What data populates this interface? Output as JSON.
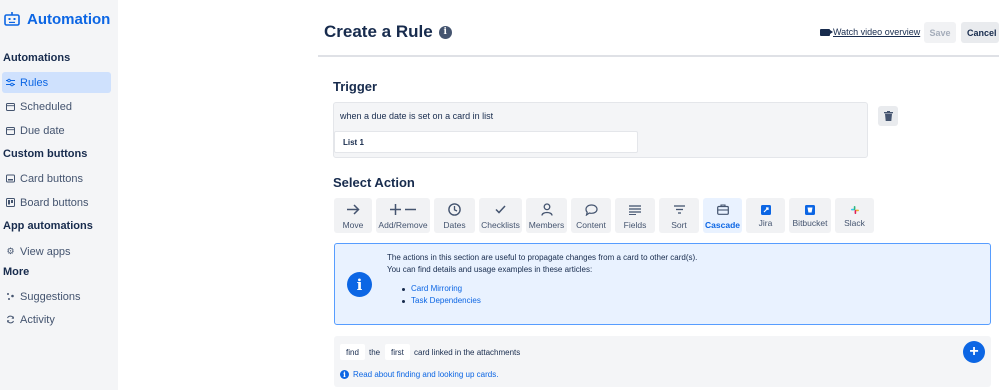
{
  "sidebar": {
    "brand": "Automation",
    "sections": {
      "automations": "Automations",
      "custom_buttons": "Custom buttons",
      "app_automations": "App automations",
      "more": "More"
    },
    "items": {
      "rules": "Rules",
      "scheduled": "Scheduled",
      "due_date": "Due date",
      "card_buttons": "Card buttons",
      "board_buttons": "Board buttons",
      "view_apps": "View apps",
      "suggestions": "Suggestions",
      "activity": "Activity"
    }
  },
  "header": {
    "title": "Create a Rule",
    "watch_video": "Watch video overview",
    "save": "Save",
    "cancel": "Cancel"
  },
  "trigger": {
    "heading": "Trigger",
    "text": "when a due date is set on a card in list",
    "list_value": "List 1"
  },
  "select_action": {
    "heading": "Select Action",
    "tabs": {
      "move": "Move",
      "add_remove": "Add/Remove",
      "dates": "Dates",
      "checklists": "Checklists",
      "members": "Members",
      "content": "Content",
      "fields": "Fields",
      "sort": "Sort",
      "cascade": "Cascade",
      "jira": "Jira",
      "bitbucket": "Bitbucket",
      "slack": "Slack"
    },
    "active_tab": "Cascade"
  },
  "info_panel": {
    "line1": "The actions in this section are useful to propagate changes from a card to other card(s).",
    "line2": "You can find details and usage examples in these articles:",
    "link1": "Card Mirroring",
    "link2": "Task Dependencies"
  },
  "action_row": {
    "find": "find",
    "the": "the",
    "first": "first",
    "suffix": "card linked in the attachments",
    "read_link": "Read about finding and looking up cards."
  },
  "colors": {
    "accent": "#0c66e4",
    "active_bg": "#cfe1fd",
    "panel_bg": "#e9f2ff"
  }
}
